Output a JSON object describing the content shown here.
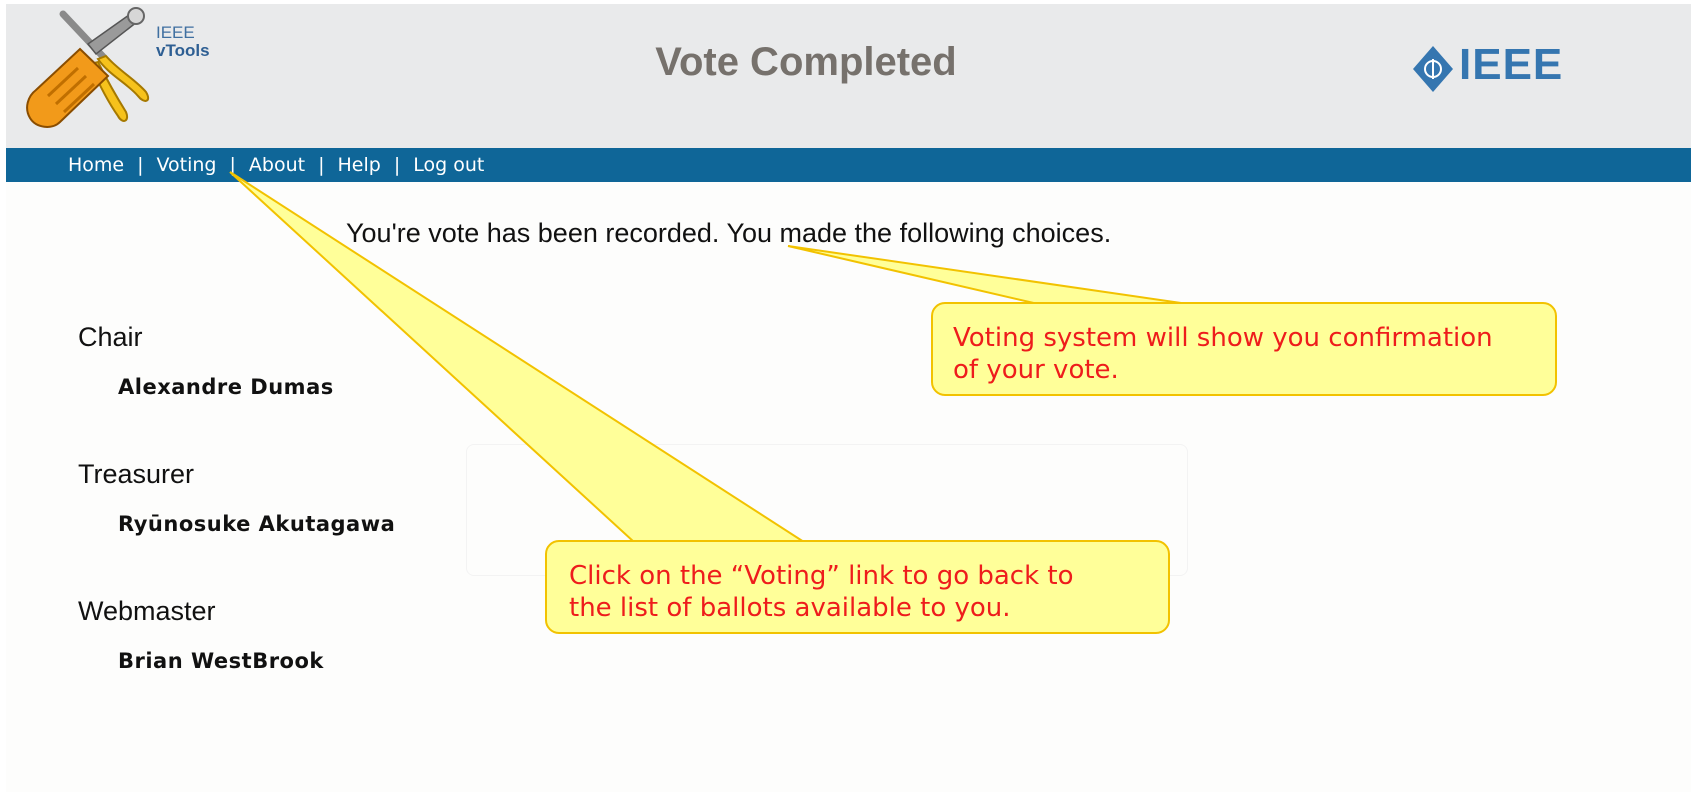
{
  "header": {
    "logo_line1": "IEEE",
    "logo_line2": "vTools",
    "title": "Vote Completed",
    "brand": "IEEE"
  },
  "nav": {
    "items": [
      "Home",
      "Voting",
      "About",
      "Help",
      "Log out"
    ],
    "separator": "|"
  },
  "main": {
    "confirmation": "You're vote has been recorded. You made the following choices.",
    "positions": [
      {
        "title": "Chair",
        "choice": "Alexandre Dumas"
      },
      {
        "title": "Treasurer",
        "choice": "Ryūnosuke Akutagawa"
      },
      {
        "title": "Webmaster",
        "choice": "Brian WestBrook"
      }
    ]
  },
  "callouts": [
    {
      "text_line1": "Voting system will show you confirmation",
      "text_line2": "of your vote."
    },
    {
      "text_line1": "Click on the “Voting” link to go back to",
      "text_line2": "the list of ballots available to you."
    }
  ],
  "colors": {
    "navbar": "#0f6698",
    "callout_fill": "#ffff99",
    "callout_border": "#f2c200",
    "callout_text": "#ee1c1c",
    "title_text": "#76716c",
    "brand": "#3576b0"
  },
  "icons": [
    "vtools-tools-icon",
    "ieee-diamond-icon"
  ]
}
